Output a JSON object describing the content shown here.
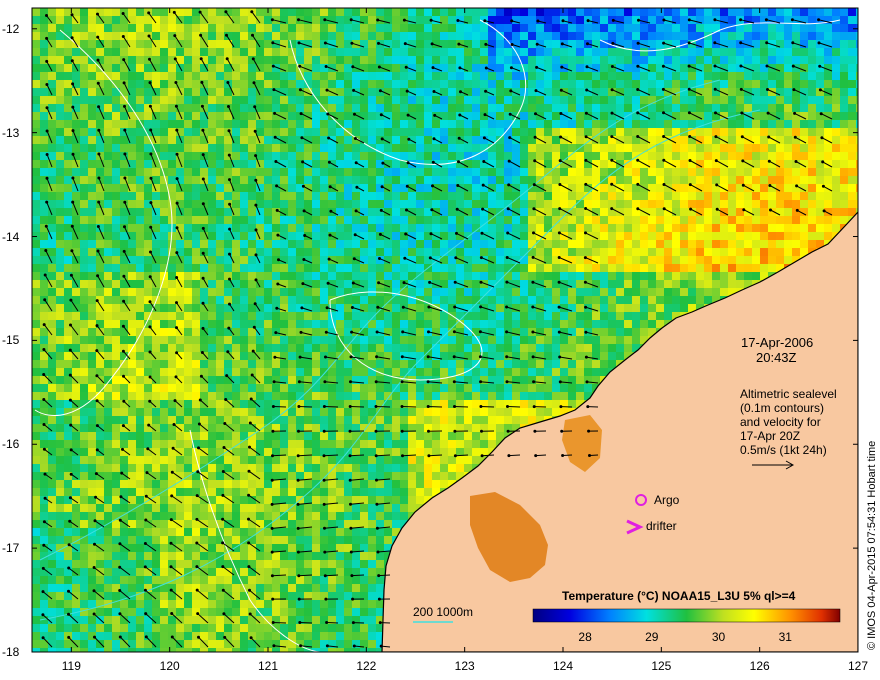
{
  "map": {
    "lon_range": [
      118.6,
      127
    ],
    "lat_range": [
      -18,
      -11.8
    ],
    "x_ticks": [
      "119",
      "120",
      "121",
      "122",
      "123",
      "124",
      "125",
      "126",
      "127"
    ],
    "y_ticks": [
      "-12",
      "-13",
      "-14",
      "-15",
      "-16",
      "-17",
      "-18"
    ],
    "land_color": "#f8c8a0",
    "coast_color": "#000000",
    "contour_color": "#ffffff",
    "bathy_color": "#40e0e0"
  },
  "info": {
    "date": "17-Apr-2006",
    "time": "20:43Z",
    "altimetry_lines": [
      "Altimetric sealevel",
      "(0.1m contours)",
      "and velocity for",
      "17-Apr 20Z",
      "0.5m/s (1kt 24h)"
    ]
  },
  "legend": {
    "argo_label": "Argo",
    "drifter_label": "drifter",
    "argo_color": "#e020e0",
    "drifter_color": "#e020e0",
    "bathy_label": "200 1000m"
  },
  "colorbar": {
    "title": "Temperature (°C) NOAA15_L3U 5% ql>=4",
    "min": 27.2,
    "max": 31.8,
    "ticks": [
      "28",
      "29",
      "30",
      "31"
    ]
  },
  "credit": "© IMOS 04-Apr-2015 07:54:31 Hobart time"
}
